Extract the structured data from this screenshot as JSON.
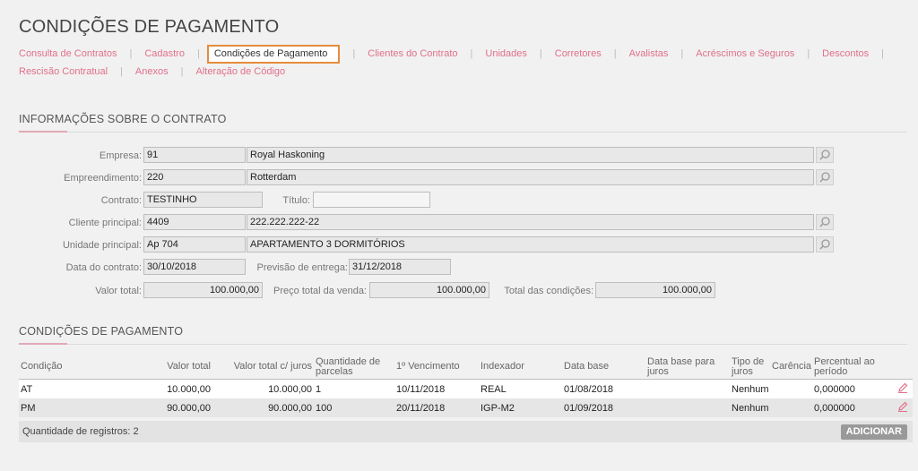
{
  "page": {
    "title": "CONDIÇÕES DE PAGAMENTO"
  },
  "tabs": [
    {
      "label": "Consulta de Contratos"
    },
    {
      "label": "Cadastro"
    },
    {
      "label": "Condições de Pagamento",
      "active": true
    },
    {
      "label": "Clientes do Contrato"
    },
    {
      "label": "Unidades"
    },
    {
      "label": "Corretores"
    },
    {
      "label": "Avalistas"
    },
    {
      "label": "Acréscimos e Seguros"
    },
    {
      "label": "Descontos"
    },
    {
      "label": "Rescisão Contratual"
    },
    {
      "label": "Anexos"
    },
    {
      "label": "Alteração de Código"
    }
  ],
  "info": {
    "section_title": "INFORMAÇÕES SOBRE O CONTRATO",
    "empresa": {
      "label": "Empresa:",
      "code": "91",
      "name": "Royal Haskoning"
    },
    "empreendimento": {
      "label": "Empreendimento:",
      "code": "220",
      "name": "Rotterdam"
    },
    "contrato": {
      "label": "Contrato:",
      "value": "TESTINHO"
    },
    "titulo": {
      "label": "Título:",
      "value": ""
    },
    "cliente": {
      "label": "Cliente principal:",
      "code": "4409",
      "name": "222.222.222-22"
    },
    "unidade": {
      "label": "Unidade principal:",
      "code": "Ap 704",
      "name": "APARTAMENTO 3 DORMITÓRIOS"
    },
    "data_contrato": {
      "label": "Data do contrato:",
      "value": "30/10/2018"
    },
    "previsao": {
      "label": "Previsão de entrega:",
      "value": "31/12/2018"
    },
    "valor_total": {
      "label": "Valor total:",
      "value": "100.000,00"
    },
    "preco_total": {
      "label": "Preço total da venda:",
      "value": "100.000,00"
    },
    "total_condicoes": {
      "label": "Total das condições:",
      "value": "100.000,00"
    }
  },
  "conditions": {
    "section_title": "CONDIÇÕES DE PAGAMENTO",
    "headers": [
      "Condição",
      "Valor total",
      "Valor total c/ juros",
      "Quantidade de parcelas",
      "1º Vencimento",
      "Indexador",
      "Data base",
      "Data base para juros",
      "Tipo de juros",
      "Carência",
      "Percentual ao período"
    ],
    "rows": [
      {
        "condicao": "AT",
        "valor_total": "10.000,00",
        "valor_juros": "10.000,00",
        "parcelas": "1",
        "vencimento": "10/11/2018",
        "indexador": "REAL",
        "data_base": "01/08/2018",
        "data_base_juros": "",
        "tipo_juros": "Nenhum",
        "carencia": "",
        "percentual": "0,000000"
      },
      {
        "condicao": "PM",
        "valor_total": "90.000,00",
        "valor_juros": "90.000,00",
        "parcelas": "100",
        "vencimento": "20/11/2018",
        "indexador": "IGP-M2",
        "data_base": "01/09/2018",
        "data_base_juros": "",
        "tipo_juros": "Nenhum",
        "carencia": "",
        "percentual": "0,000000"
      }
    ],
    "record_count": "Quantidade de registros: 2",
    "add_label": "ADICIONAR"
  },
  "colors": {
    "accent": "#e0708a",
    "active_border": "#e58c3c"
  }
}
